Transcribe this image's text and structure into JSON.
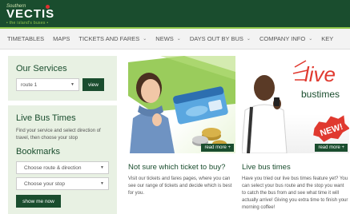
{
  "brand": {
    "small_text": "Southern",
    "name": "VECTIS",
    "tagline": "• the island's buses •",
    "accent_color": "#8fc74a",
    "primary_color": "#1a4d2e"
  },
  "nav": {
    "items": [
      {
        "label": "TIMETABLES",
        "has_dropdown": false
      },
      {
        "label": "MAPS",
        "has_dropdown": false
      },
      {
        "label": "TICKETS AND FARES",
        "has_dropdown": true
      },
      {
        "label": "NEWS",
        "has_dropdown": true
      },
      {
        "label": "DAYS OUT BY BUS",
        "has_dropdown": true
      },
      {
        "label": "COMPANY INFO",
        "has_dropdown": true
      },
      {
        "label": "KEY",
        "has_dropdown": false
      }
    ]
  },
  "services": {
    "title": "Our Services",
    "route_value": "route 1",
    "view_label": "view"
  },
  "live": {
    "title": "Live Bus Times",
    "description": "Find your service and select direction of travel, then choose your stop",
    "bookmarks_title": "Bookmarks",
    "route_dir_placeholder": "Choose route & direction",
    "stop_placeholder": "Choose your stop",
    "show_button": "show me now"
  },
  "cards": [
    {
      "image_alt": "woman thinking with bus ticket and coins",
      "read_more": "read more +",
      "title": "Not sure which ticket to buy?",
      "text": "Visit our tickets and fares pages, where you can see our range of tickets and decide which is best for you."
    },
    {
      "image_alt": "man with phone, live bustimes NEW",
      "image_text_1": "live",
      "image_text_2": "bustimes",
      "badge": "NEW!",
      "read_more": "read more +",
      "title": "Live bus times",
      "text": "Have you tried our live bus times feature yet? You can select your bus route and the stop you want to catch the bus from and see what time it will actually arrive! Giving you extra time to finish your morning coffee!"
    }
  ]
}
